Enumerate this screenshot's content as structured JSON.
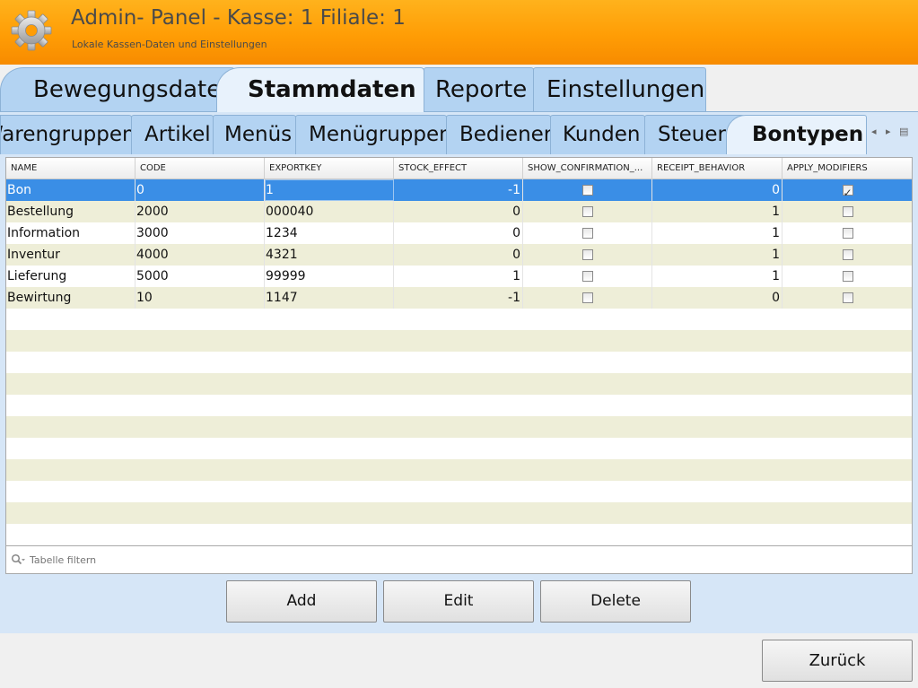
{
  "app": {
    "title": "Admin- Panel - Kasse: 1 Filiale: 1",
    "subtitle": "Lokale Kassen-Daten und Einstellungen"
  },
  "main_tabs": [
    {
      "label": "Bewegungsdaten",
      "active": false
    },
    {
      "label": "Stammdaten",
      "active": true
    },
    {
      "label": "Reporte",
      "active": false
    },
    {
      "label": "Einstellungen",
      "active": false
    }
  ],
  "sub_tabs": [
    {
      "label": "Warengruppen",
      "active": false
    },
    {
      "label": "Artikel",
      "active": false
    },
    {
      "label": "Menüs",
      "active": false
    },
    {
      "label": "Menügruppen",
      "active": false
    },
    {
      "label": "Bediener",
      "active": false
    },
    {
      "label": "Kunden",
      "active": false
    },
    {
      "label": "Steuern",
      "active": false
    },
    {
      "label": "Bontypen",
      "active": true
    }
  ],
  "sub_tab_scroll": {
    "left": "◂",
    "right": "▸",
    "menu": "▤"
  },
  "table": {
    "columns": [
      "NAME",
      "CODE",
      "EXPORTKEY",
      "STOCK_EFFECT",
      "SHOW_CONFIRMATION_...",
      "RECEIPT_BEHAVIOR",
      "APPLY_MODIFIERS"
    ],
    "rows": [
      {
        "name": "Bon",
        "code": "0",
        "exportkey": "1",
        "stock_effect": "-1",
        "show_confirmation": false,
        "receipt_behavior": "0",
        "apply_modifiers": true,
        "selected": true
      },
      {
        "name": "Bestellung",
        "code": "2000",
        "exportkey": "000040",
        "stock_effect": "0",
        "show_confirmation": false,
        "receipt_behavior": "1",
        "apply_modifiers": false,
        "selected": false
      },
      {
        "name": "Information",
        "code": "3000",
        "exportkey": "1234",
        "stock_effect": "0",
        "show_confirmation": false,
        "receipt_behavior": "1",
        "apply_modifiers": false,
        "selected": false
      },
      {
        "name": "Inventur",
        "code": "4000",
        "exportkey": "4321",
        "stock_effect": "0",
        "show_confirmation": false,
        "receipt_behavior": "1",
        "apply_modifiers": false,
        "selected": false
      },
      {
        "name": "Lieferung",
        "code": "5000",
        "exportkey": "99999",
        "stock_effect": "1",
        "show_confirmation": false,
        "receipt_behavior": "1",
        "apply_modifiers": false,
        "selected": false
      },
      {
        "name": "Bewirtung",
        "code": "10",
        "exportkey": "1147",
        "stock_effect": "-1",
        "show_confirmation": false,
        "receipt_behavior": "0",
        "apply_modifiers": false,
        "selected": false
      }
    ]
  },
  "filter": {
    "placeholder": "Tabelle filtern",
    "value": ""
  },
  "actions": {
    "add": "Add",
    "edit": "Edit",
    "delete": "Delete"
  },
  "back": "Zurück",
  "colors": {
    "header_orange": "#ff9d05",
    "tab_blue": "#b3d3f2",
    "tab_active": "#e8f2fc",
    "selection_blue": "#3a8ee6",
    "row_alt": "#eeeed8"
  }
}
